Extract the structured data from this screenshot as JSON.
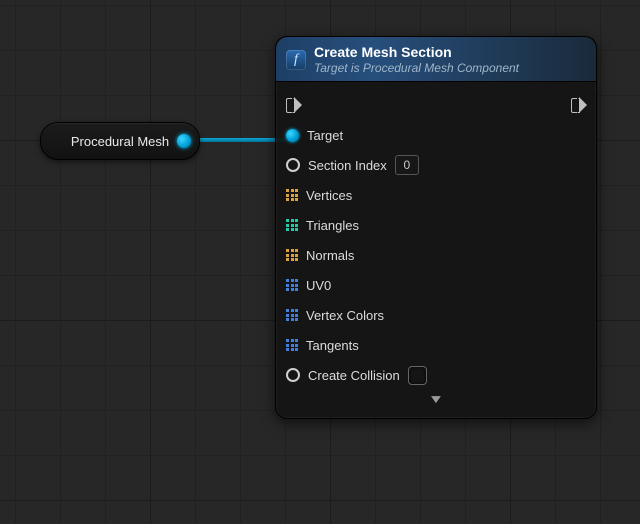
{
  "variable": {
    "label": "Procedural Mesh"
  },
  "node": {
    "title": "Create Mesh Section",
    "subtitle": "Target is Procedural Mesh Component",
    "pins": {
      "target": {
        "label": "Target"
      },
      "section_index": {
        "label": "Section Index",
        "value": "0"
      },
      "vertices": {
        "label": "Vertices"
      },
      "triangles": {
        "label": "Triangles"
      },
      "normals": {
        "label": "Normals"
      },
      "uv0": {
        "label": "UV0"
      },
      "vertex_colors": {
        "label": "Vertex Colors"
      },
      "tangents": {
        "label": "Tangents"
      },
      "create_collision": {
        "label": "Create Collision"
      }
    }
  }
}
